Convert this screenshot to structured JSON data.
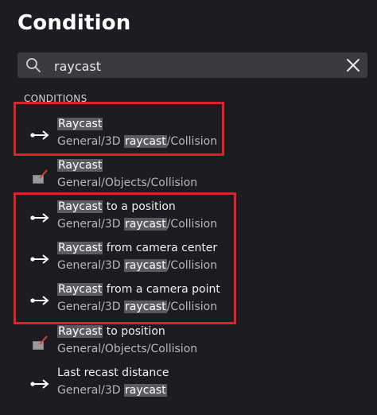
{
  "header": {
    "title": "Condition"
  },
  "search": {
    "value": "raycast"
  },
  "section_label": "CONDITIONS",
  "items": [
    {
      "name_hl": "Raycast",
      "name_rest": "",
      "path_pre": "General/3D ",
      "path_hl": "raycast",
      "path_post": "/Collision",
      "icon": "arrow-right-icon"
    },
    {
      "name_hl": "Raycast",
      "name_rest": "",
      "path_pre": "General/Objects/Collision",
      "path_hl": "",
      "path_post": "",
      "icon": "collision-box-icon"
    },
    {
      "name_hl": "Raycast",
      "name_rest": " to a position",
      "path_pre": "General/3D ",
      "path_hl": "raycast",
      "path_post": "/Collision",
      "icon": "arrow-right-icon"
    },
    {
      "name_hl": "Raycast",
      "name_rest": " from camera center",
      "path_pre": "General/3D ",
      "path_hl": "raycast",
      "path_post": "/Collision",
      "icon": "arrow-right-icon"
    },
    {
      "name_hl": "Raycast",
      "name_rest": " from a camera point",
      "path_pre": "General/3D ",
      "path_hl": "raycast",
      "path_post": "/Collision",
      "icon": "arrow-right-icon"
    },
    {
      "name_hl": "Raycast",
      "name_rest": " to position",
      "path_pre": "General/Objects/Collision",
      "path_hl": "",
      "path_post": "",
      "icon": "collision-box-icon"
    },
    {
      "name_hl": "",
      "name_rest": "Last recast distance",
      "path_pre": "General/3D ",
      "path_hl": "raycast",
      "path_post": "",
      "icon": "arrow-right-icon"
    }
  ],
  "colors": {
    "highlight_box": "#e0202a",
    "background": "#1d1d21",
    "search_bg": "#3a3b3f"
  }
}
